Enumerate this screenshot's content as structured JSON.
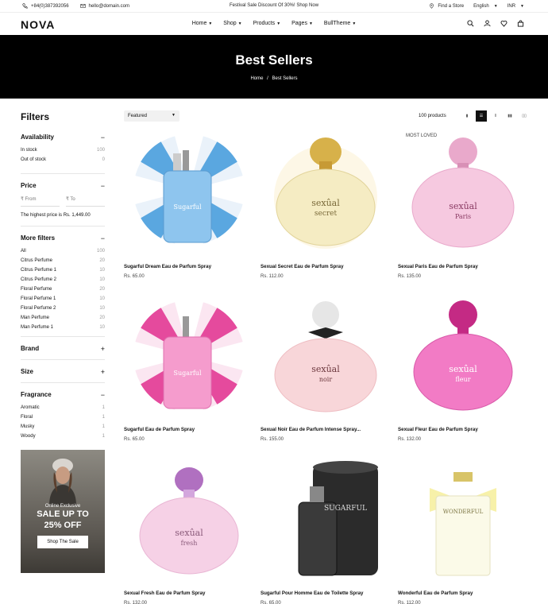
{
  "topbar": {
    "phone": "+84(0)387392056",
    "email": "hello@domain.com",
    "announcement": "Festival Sale Discount Of 30%! Shop Now",
    "store": "Find a Store",
    "language": "English",
    "currency": "INR"
  },
  "header": {
    "logo": "NOVA",
    "nav": [
      "Home",
      "Shop",
      "Products",
      "Pages",
      "BullTheme"
    ]
  },
  "hero": {
    "title": "Best Sellers",
    "breadcrumb_home": "Home",
    "breadcrumb_sep": "/",
    "breadcrumb_current": "Best Sellers"
  },
  "filters": {
    "title": "Filters",
    "availability": {
      "label": "Availability",
      "items": [
        {
          "label": "In stock",
          "count": "100"
        },
        {
          "label": "Out of stock",
          "count": "0"
        }
      ]
    },
    "price": {
      "label": "Price",
      "from": "From",
      "to": "To",
      "hint": "The highest price is Rs. 1,449.00"
    },
    "more": {
      "label": "More filters",
      "items": [
        {
          "label": "All",
          "count": "100"
        },
        {
          "label": "Citrus Perfume",
          "count": "20"
        },
        {
          "label": "Citrus Perfume 1",
          "count": "10"
        },
        {
          "label": "Citrus Perfume 2",
          "count": "10"
        },
        {
          "label": "Floral Perfume",
          "count": "20"
        },
        {
          "label": "Floral Perfume 1",
          "count": "10"
        },
        {
          "label": "Floral Perfume 2",
          "count": "10"
        },
        {
          "label": "Man Perfume",
          "count": "20"
        },
        {
          "label": "Man Perfume 1",
          "count": "10"
        }
      ]
    },
    "brand": "Brand",
    "size": "Size",
    "fragrance": {
      "label": "Fragrance",
      "items": [
        {
          "label": "Aromatic",
          "count": "1"
        },
        {
          "label": "Floral",
          "count": "1"
        },
        {
          "label": "Musky",
          "count": "1"
        },
        {
          "label": "Woody",
          "count": "1"
        }
      ]
    }
  },
  "promo": {
    "eyebrow": "Online Exclusive",
    "headline1": "SALE UP TO",
    "headline2": "25% OFF",
    "button": "Shop The Sale"
  },
  "toolbar": {
    "sort": "Featured",
    "count": "100 products"
  },
  "products": [
    {
      "name": "Sugarful Dream Eau de Parfum Spray",
      "price": "Rs. 65.00",
      "tag": "",
      "style": "blue-swirl"
    },
    {
      "name": "Sexual Secret Eau de Parfum Spray",
      "price": "Rs. 112.00",
      "tag": "",
      "style": "gold"
    },
    {
      "name": "Sexual Paris Eau de Parfum Spray",
      "price": "Rs. 135.00",
      "tag": "MOST LOVED",
      "style": "pink-jewel"
    },
    {
      "name": "Sugarful Eau de Parfum Spray",
      "price": "Rs. 65.00",
      "tag": "",
      "style": "pink-swirl"
    },
    {
      "name": "Sexual Noir Eau de Parfum Intense Spray...",
      "price": "Rs. 155.00",
      "tag": "",
      "style": "noir"
    },
    {
      "name": "Sexual Fleur Eau de Parfum Spray",
      "price": "Rs. 132.00",
      "tag": "",
      "style": "fuchsia"
    },
    {
      "name": "Sexual Fresh Eau de Parfum Spray",
      "price": "Rs. 132.00",
      "tag": "",
      "style": "lilac"
    },
    {
      "name": "Sugarful Pour Homme Eau de Toilette Spray",
      "price": "Rs. 65.00",
      "tag": "",
      "style": "black"
    },
    {
      "name": "Wonderful Eau de Parfum Spray",
      "price": "Rs. 112.00",
      "tag": "",
      "style": "yellow-bow"
    }
  ]
}
